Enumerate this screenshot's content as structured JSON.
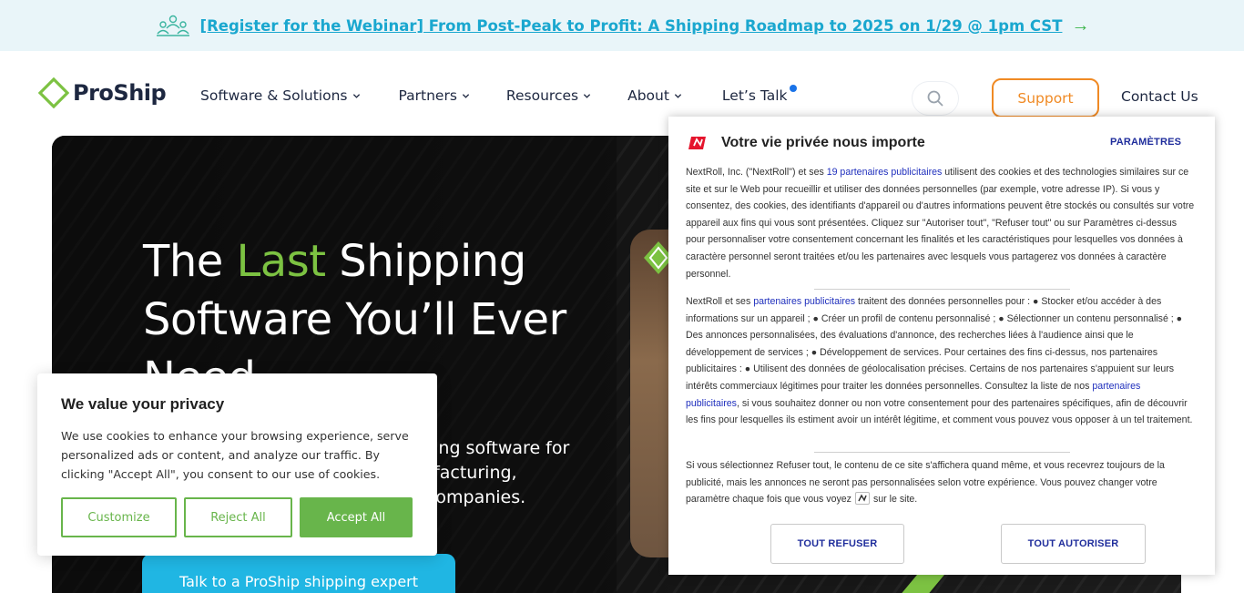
{
  "announcement": {
    "icon": "people-group-icon",
    "text": "[Register for the Webinar] From Post-Peak to Profit: A Shipping Roadmap to 2025 on 1/29 @ 1pm CST",
    "arrow": "→"
  },
  "header": {
    "logo_text": "ProShip",
    "nav": [
      {
        "label": "Software & Solutions"
      },
      {
        "label": "Partners"
      },
      {
        "label": "Resources"
      },
      {
        "label": "About"
      },
      {
        "label": "Let’s Talk"
      }
    ],
    "support_label": "Support",
    "contact_label": "Contact Us"
  },
  "hero": {
    "title_pre": "The ",
    "title_accent": "Last",
    "title_post": " Shipping Software You’ll Ever Need",
    "subtitle": "…pping software for …nufacturing, …s companies.",
    "subtitle_lines": [
      "pping software for",
      "nufacturing,",
      "s companies."
    ],
    "cta_label": "Talk to a ProShip shipping expert"
  },
  "cookie_banner": {
    "title": "We value your privacy",
    "text": "We use cookies to enhance your browsing experience, serve personalized ads or content, and analyze our traffic. By clicking \"Accept All\", you consent to our use of cookies.",
    "customize_label": "Customize",
    "reject_label": "Reject All",
    "accept_label": "Accept All"
  },
  "nextroll": {
    "title": "Votre vie privée nous importe",
    "params_label": "PARAMÈTRES",
    "p1_a": "NextRoll, Inc. (\"NextRoll\") et ses ",
    "p1_link": "19 partenaires publicitaires",
    "p1_b": " utilisent des cookies et des technologies similaires sur ce site et sur le Web pour recueillir et utiliser des données personnelles (par exemple, votre adresse IP). Si vous y consentez, des cookies, des identifiants d'appareil ou d'autres informations peuvent être stockés ou consultés sur votre appareil aux fins qui vous sont présentées. Cliquez sur \"Autoriser tout\", \"Refuser tout\" ou sur Paramètres ci-dessus pour personnaliser votre consentement concernant les finalités et les caractéristiques pour lesquelles vos données à caractère personnel seront traitées et/ou les partenaires avec lesquels vous partagerez vos données à caractère personnel.",
    "p2_a": "NextRoll et ses ",
    "p2_link1": "partenaires publicitaires",
    "p2_b": " traitent des données personnelles pour : ● Stocker et/ou accéder à des informations sur un appareil ; ● Créer un profil de contenu personnalisé ; ● Sélectionner un contenu personnalisé ; ● Des annonces personnalisées, des évaluations d'annonce, des recherches liées à l'audience ainsi que le développement de services ; ● Développement de services. Pour certaines des fins ci-dessus, nos partenaires publicitaires : ● Utilisent des données de géolocalisation précises. Certains de nos partenaires s'appuient sur leurs intérêts commerciaux légitimes pour traiter les données personnelles. Consultez la liste de nos ",
    "p2_link2": "partenaires publicitaires",
    "p2_c": ", si vous souhaitez donner ou non votre consentement pour des partenaires spécifiques, afin de découvrir les fins pour lesquelles ils estiment avoir un intérêt légitime, et comment vous pouvez vous opposer à un tel traitement.",
    "p3_a": "Si vous sélectionnez Refuser tout, le contenu de ce site s'affichera quand même, et vous recevrez toujours de la publicité, mais les annonces ne seront pas personnalisées selon votre expérience. Vous pouvez changer votre paramètre chaque fois que vous voyez",
    "p3_b": "sur le site.",
    "refuse_label": "TOUT REFUSER",
    "allow_label": "TOUT AUTORISER"
  },
  "colors": {
    "brand_green": "#7cc242",
    "cta_blue": "#20b6e3",
    "support_orange": "#f08a24",
    "accept_green": "#68b54b",
    "nextroll_red": "#e5142c",
    "nextroll_blue": "#1f2d9c"
  }
}
